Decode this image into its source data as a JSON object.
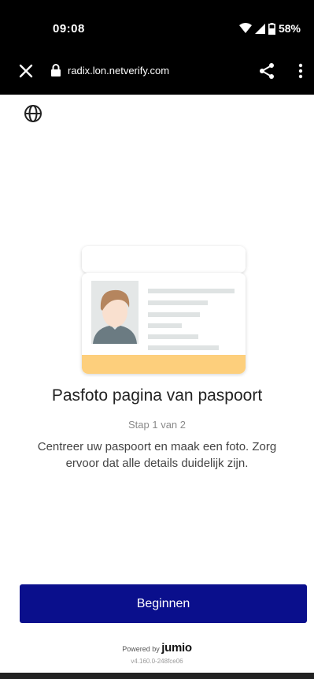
{
  "status_bar": {
    "time": "09:08",
    "battery": "58%"
  },
  "toolbar": {
    "url": "radix.lon.netverify.com"
  },
  "icons": {
    "close": "close-icon",
    "lock": "lock-icon",
    "share": "share-icon",
    "menu": "more-vert-icon",
    "language": "globe-icon"
  },
  "main": {
    "title": "Pasfoto pagina van paspoort",
    "step": "Stap 1 van 2",
    "description": "Centreer uw paspoort en maak een foto. Zorg ervoor dat alle details duidelijk zijn."
  },
  "action": {
    "start_label": "Beginnen"
  },
  "footer": {
    "powered_prefix": "Powered by",
    "brand": "jumio",
    "version": "v4.160.0-248fce06"
  },
  "colors": {
    "primary_button": "#0a0f8c",
    "card_accent": "#fdcf7c",
    "system_bar": "#000000"
  }
}
